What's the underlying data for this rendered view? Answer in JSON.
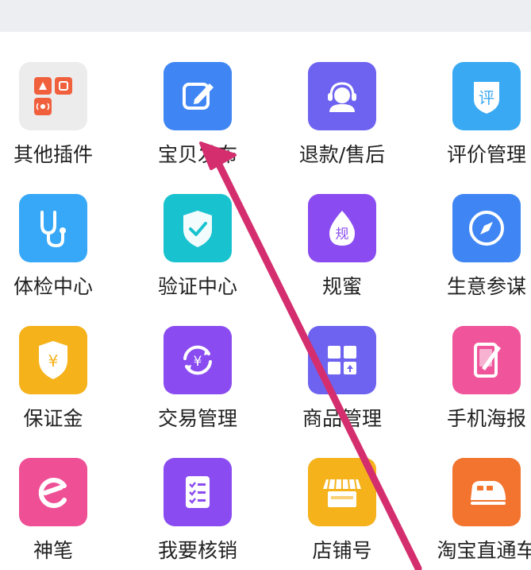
{
  "grid": {
    "items": [
      {
        "label": "其他插件",
        "icon": "plugins-icon",
        "color": "#ececec"
      },
      {
        "label": "宝贝发布",
        "icon": "edit-icon",
        "color": "#3f86f4"
      },
      {
        "label": "退款/售后",
        "icon": "customer-service-icon",
        "color": "#6e63f0"
      },
      {
        "label": "评价管理",
        "icon": "review-icon",
        "color": "#38a9f2",
        "glyph": "评"
      },
      {
        "label": "体检中心",
        "icon": "stethoscope-icon",
        "color": "#37a8f7"
      },
      {
        "label": "验证中心",
        "icon": "shield-check-icon",
        "color": "#18c3cf"
      },
      {
        "label": "规蜜",
        "icon": "drop-icon",
        "color": "#8a4cf0",
        "glyph": "规"
      },
      {
        "label": "生意参谋",
        "icon": "compass-icon",
        "color": "#3f86f4"
      },
      {
        "label": "保证金",
        "icon": "yuan-shield-icon",
        "color": "#f5b21b",
        "glyph": "¥"
      },
      {
        "label": "交易管理",
        "icon": "yuan-cycle-icon",
        "color": "#8a4cf0",
        "glyph": "¥"
      },
      {
        "label": "商品管理",
        "icon": "product-grid-icon",
        "color": "#6e63f0"
      },
      {
        "label": "手机海报",
        "icon": "phone-poster-icon",
        "color": "#f0549a"
      },
      {
        "label": "神笔",
        "icon": "pen-e-icon",
        "color": "#ee4f95"
      },
      {
        "label": "我要核销",
        "icon": "checklist-icon",
        "color": "#8a4cf0"
      },
      {
        "label": "店铺号",
        "icon": "store-icon",
        "color": "#f5b21b"
      },
      {
        "label": "淘宝直通车",
        "icon": "train-icon",
        "color": "#f2742e"
      }
    ]
  },
  "annotation": {
    "icon": "pointer-arrow-icon",
    "color": "#d42e6e"
  }
}
